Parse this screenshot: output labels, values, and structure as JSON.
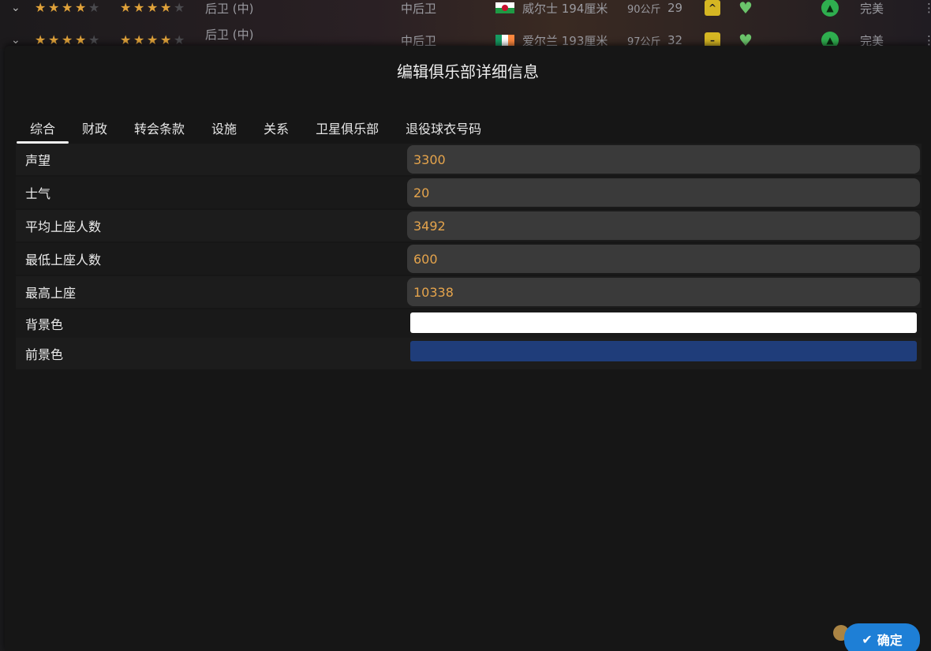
{
  "background_list": {
    "rows": [
      {
        "position_a": "后卫 (中)",
        "position_b": "中后卫",
        "nationality_info": "威尔士 194厘米",
        "weight": "90公斤",
        "age": "29",
        "condition": "完美",
        "flag_colors": [
          "#ffffff",
          "#1e9a44",
          "#c8102e"
        ]
      },
      {
        "position_a": "后卫 (中)",
        "position_b": "中后卫",
        "nationality_info": "爱尔兰 193厘米",
        "weight": "97公斤",
        "age": "32",
        "condition": "完美",
        "flag_colors": [
          "#169b62",
          "#ffffff",
          "#ff883e"
        ]
      }
    ]
  },
  "dialog": {
    "title": "编辑俱乐部详细信息",
    "tabs": [
      {
        "label": "综合",
        "active": true
      },
      {
        "label": "财政",
        "active": false
      },
      {
        "label": "转会条款",
        "active": false
      },
      {
        "label": "设施",
        "active": false
      },
      {
        "label": "关系",
        "active": false
      },
      {
        "label": "卫星俱乐部",
        "active": false
      },
      {
        "label": "退役球衣号码",
        "active": false
      }
    ],
    "fields": [
      {
        "label": "声望",
        "value": "3300"
      },
      {
        "label": "士气",
        "value": "20"
      },
      {
        "label": "平均上座人数",
        "value": "3492"
      },
      {
        "label": "最低上座人数",
        "value": "600"
      },
      {
        "label": "最高上座",
        "value": "10338"
      }
    ],
    "color_fields": [
      {
        "label": "背景色",
        "color": "#ffffff"
      },
      {
        "label": "前景色",
        "color": "#1f3d7a"
      }
    ],
    "confirm_label": "确定",
    "confirm_icon": "checkmark-icon"
  },
  "colors": {
    "accent": "#1e7fd6",
    "value_text": "#e5a44c"
  }
}
